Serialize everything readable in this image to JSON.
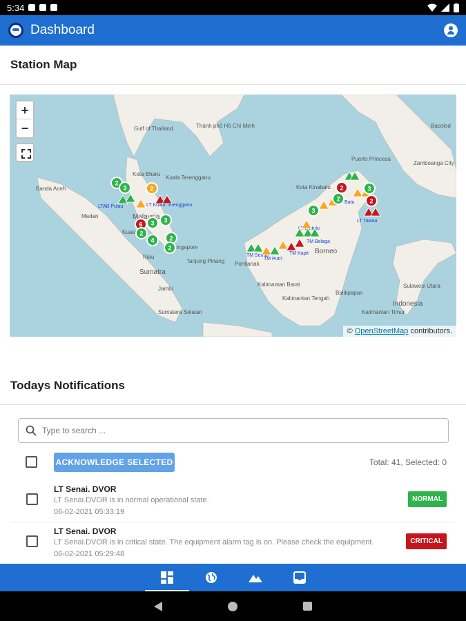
{
  "status_bar": {
    "time": "5:34"
  },
  "app_bar": {
    "title": "Dashboard"
  },
  "station_map": {
    "title": "Station Map",
    "zoom_in": "+",
    "zoom_out": "−",
    "attribution_prefix": "©",
    "attribution_link": "OpenStreetMap",
    "attribution_suffix": "contributors.",
    "labels": [
      "Banda Aceh",
      "Medan",
      "Kota Bharu",
      "Kuala Terengganu",
      "Malaysia",
      "Kuala",
      "Singapore",
      "Sumatra",
      "Riau",
      "Jambi",
      "Sumatera Selatan",
      "Tanjung Pinang",
      "Thành phố Hồ Chí Minh",
      "Gulf of Thailand",
      "Puerto Princesa",
      "Zamboanga City",
      "Kota Kinabalu",
      "Pontianak",
      "Borneo",
      "Kalimantan Barat",
      "Kalimantan Tengah",
      "Balikpapan",
      "Indonesia",
      "Bacolod",
      "Kalimantan Timur",
      "Sulawesi Utara"
    ],
    "station_labels": [
      "LTAB Pulau",
      "LT Kuala Terengganu",
      "TM Batu",
      "LT Tawau",
      "TM Semat",
      "TM Putrí",
      "TM Kapit",
      "TM Belaga",
      "LT Bintulu"
    ],
    "clusters": [
      {
        "count": "2",
        "status": "normal"
      },
      {
        "count": "3",
        "status": "normal"
      },
      {
        "count": "2",
        "status": "warning"
      },
      {
        "count": "3",
        "status": "normal"
      },
      {
        "count": "6",
        "status": "critical"
      },
      {
        "count": "3",
        "status": "normal"
      },
      {
        "count": "2",
        "status": "normal"
      },
      {
        "count": "4",
        "status": "normal"
      },
      {
        "count": "2",
        "status": "normal"
      },
      {
        "count": "2",
        "status": "normal"
      },
      {
        "count": "3",
        "status": "normal"
      },
      {
        "count": "2",
        "status": "normal"
      },
      {
        "count": "2",
        "status": "critical"
      },
      {
        "count": "3",
        "status": "normal"
      },
      {
        "count": "2",
        "status": "critical"
      }
    ]
  },
  "notifications": {
    "title": "Todays Notifications",
    "search_placeholder": "Type to search ...",
    "acknowledge_label": "ACKNOWLEDGE SELECTED",
    "totals": "Total: 41, Selected: 0",
    "items": [
      {
        "title": "LT Senai. DVOR",
        "message": "LT Senai.DVOR is in normal operational state.",
        "time": "06-02-2021 05:33:19",
        "badge": "NORMAL"
      },
      {
        "title": "LT Senai. DVOR",
        "message": "LT Senai.DVOR is in critical state. The equipment alarm tag is on. Please check the equipment.",
        "time": "06-02-2021 05:29:48",
        "badge": "CRITICAL"
      }
    ]
  },
  "colors": {
    "primary": "#1e6fd1",
    "normal": "#2eb44a",
    "critical": "#c4161c",
    "warning": "#f5a623",
    "sea": "#aad3df",
    "land": "#f2efe9"
  },
  "bottom_nav": {
    "items": [
      {
        "icon": "dashboard-icon",
        "active": true
      },
      {
        "icon": "globe-icon",
        "active": false
      },
      {
        "icon": "mountain-icon",
        "active": false
      },
      {
        "icon": "inbox-icon",
        "active": false
      }
    ]
  }
}
